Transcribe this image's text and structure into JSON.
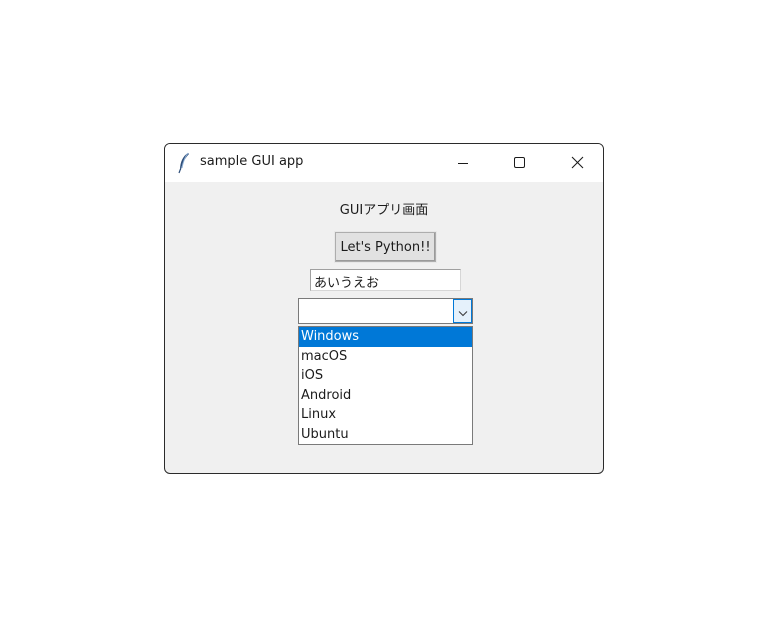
{
  "window": {
    "title": "sample GUI app",
    "app_icon": "feather-icon",
    "controls": {
      "minimize_icon": "minimize-icon",
      "maximize_icon": "maximize-icon",
      "close_icon": "close-icon"
    }
  },
  "content": {
    "label": "GUIアプリ画面",
    "button_label": "Let's Python!!",
    "entry_value": "あいうえお",
    "combobox": {
      "value": "",
      "arrow_icon": "chevron-down-icon",
      "options": [
        "Windows",
        "macOS",
        "iOS",
        "Android",
        "Linux",
        "Ubuntu"
      ],
      "highlighted_option": "Windows"
    }
  },
  "colors": {
    "window_bg": "#f0f0f0",
    "titlebar_bg": "#ffffff",
    "selection": "#0078d7",
    "accent": "#0078d7"
  }
}
